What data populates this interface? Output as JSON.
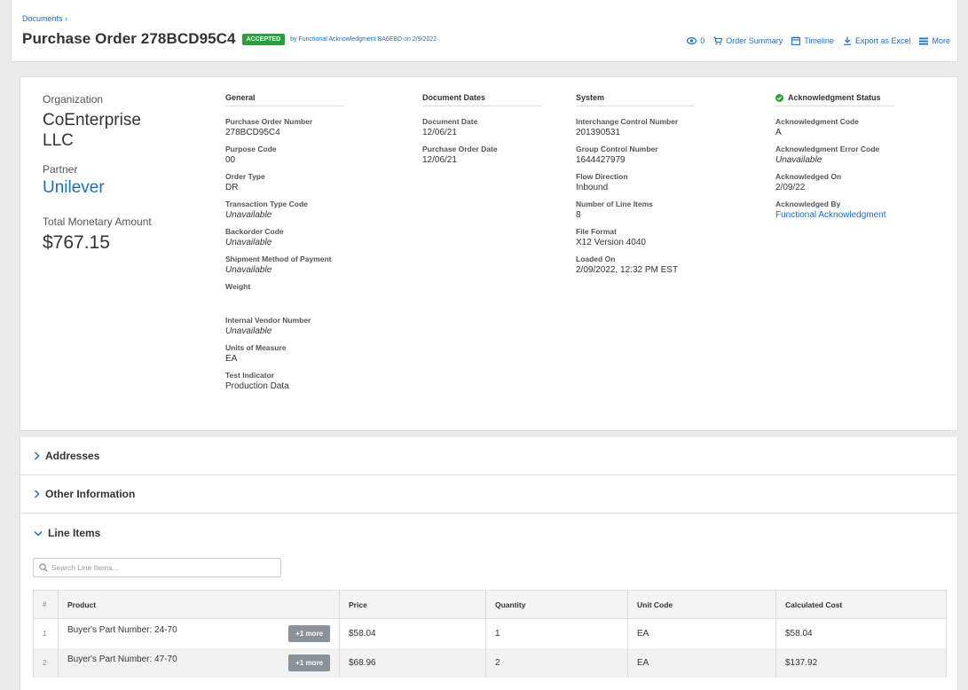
{
  "header": {
    "breadcrumb": "Documents ›",
    "title": "Purchase Order 278BCD95C4",
    "status_badge": "ACCEPTED",
    "ack_text": "by Functional Acknowledgment BA6EBD on 2/9/2022",
    "actions": {
      "views_count": "0",
      "order_summary": "Order Summary",
      "timeline": "Timeline",
      "export": "Export as Excel",
      "more": "More"
    }
  },
  "summary": {
    "organization_label": "Organization",
    "organization": "CoEnterprise LLC",
    "partner_label": "Partner",
    "partner": "Unilever",
    "total_label": "Total Monetary Amount",
    "total": "$767.15"
  },
  "general": {
    "heading": "General",
    "fields": [
      {
        "label": "Purchase Order Number",
        "value": "278BCD95C4"
      },
      {
        "label": "Purpose Code",
        "value": "00"
      },
      {
        "label": "Order Type",
        "value": "DR"
      },
      {
        "label": "Transaction Type Code",
        "value": "Unavailable"
      },
      {
        "label": "Backorder Code",
        "value": "Unavailable"
      },
      {
        "label": "Shipment Method of Payment",
        "value": "Unavailable"
      },
      {
        "label": "Weight",
        "value": ""
      },
      {
        "label": "Internal Vendor Number",
        "value": "Unavailable"
      },
      {
        "label": "Units of Measure",
        "value": "EA"
      },
      {
        "label": "Test Indicator",
        "value": "Production Data"
      }
    ]
  },
  "dates": {
    "heading": "Document Dates",
    "fields": [
      {
        "label": "Document Date",
        "value": "12/06/21"
      },
      {
        "label": "Purchase Order Date",
        "value": "12/06/21"
      }
    ]
  },
  "system": {
    "heading": "System",
    "fields": [
      {
        "label": "Interchange Control Number",
        "value": "201390531"
      },
      {
        "label": "Group Control Number",
        "value": "1644427979"
      },
      {
        "label": "Flow Direction",
        "value": "Inbound"
      },
      {
        "label": "Number of Line Items",
        "value": "8"
      },
      {
        "label": "File Format",
        "value": "X12 Version 4040"
      },
      {
        "label": "Loaded On",
        "value": "2/09/2022, 12:32 PM EST"
      }
    ]
  },
  "ack": {
    "heading": "Acknowledgment Status",
    "fields": [
      {
        "label": "Acknowledgment Code",
        "value": "A"
      },
      {
        "label": "Acknowledgment Error Code",
        "value": "Unavailable"
      },
      {
        "label": "Acknowledged On",
        "value": "2/09/22"
      },
      {
        "label": "Acknowledged By",
        "value": "Functional Acknowledgment"
      }
    ]
  },
  "sections": {
    "addresses": "Addresses",
    "other": "Other Information",
    "line_items": "Line Items"
  },
  "line_items": {
    "search_placeholder": "Search Line Items...",
    "columns": [
      "#",
      "Product",
      "Price",
      "Quantity",
      "Unit Code",
      "Calculated Cost"
    ],
    "rows": [
      {
        "num": "1",
        "product": "Buyer's Part Number: 24-70",
        "more": "+1 more",
        "price": "$58.04",
        "quantity": "1",
        "unit": "EA",
        "cost": "$58.04"
      },
      {
        "num": "2",
        "product": "Buyer's Part Number: 47-70",
        "more": "+1 more",
        "price": "$68.96",
        "quantity": "2",
        "unit": "EA",
        "cost": "$137.92"
      }
    ]
  },
  "colors": {
    "accent": "#1a6fbf",
    "success": "#2e9e3a",
    "more_button": "#8a9199"
  }
}
